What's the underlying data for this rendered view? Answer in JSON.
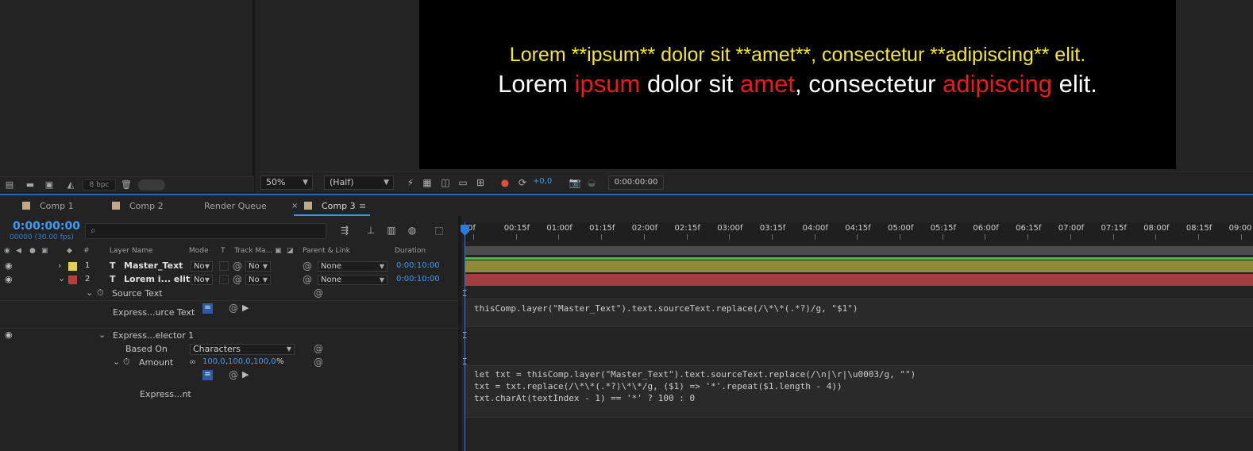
{
  "viewer": {
    "line1": [
      "Lorem ",
      "**ipsum**",
      " dolor sit ",
      "**amet**",
      ", consectetur ",
      "**adipiscing**",
      " elit."
    ],
    "line2_a": "Lorem ",
    "line2_b": "ipsum",
    "line2_c": " dolor sit ",
    "line2_d": "amet",
    "line2_e": ", consectetur ",
    "line2_f": "adipiscing",
    "line2_g": " elit.",
    "zoom": "50%",
    "resolution": "(Half)",
    "exposure": "+0,0",
    "timecode": "0:00:00:00"
  },
  "project": {
    "bpc": "8 bpc"
  },
  "tabs": [
    {
      "label": "Comp 1"
    },
    {
      "label": "Comp 2"
    },
    {
      "label": "Render Queue"
    },
    {
      "label": "Comp 3"
    }
  ],
  "timeline": {
    "current_time": "0:00:00:00",
    "current_frames": "00000 (30.00 fps)",
    "columns": {
      "num": "#",
      "layer_name": "Layer Name",
      "mode": "Mode",
      "t": "T",
      "track_matte": "Track Ma...",
      "parent": "Parent & Link",
      "duration": "Duration"
    },
    "layers": [
      {
        "num": "1",
        "name": "Master_Text",
        "mode": "No",
        "track": "No",
        "parent": "None",
        "duration": "0:00:10:00"
      },
      {
        "num": "2",
        "name": "Lorem i... elit.",
        "mode": "No",
        "track": "No",
        "parent": "None",
        "duration": "0:00:10:00"
      }
    ],
    "props": {
      "source_text": "Source Text",
      "expr_source": "Express...urce Text",
      "expr_selector": "Express...elector 1",
      "based_on": "Based On",
      "based_on_value": "Characters",
      "amount": "Amount",
      "amount_v1": "100,0",
      "amount_v2": "100,0",
      "amount_v3": "100,0",
      "amount_unit": "%",
      "expr_amount": "Express...nt"
    },
    "ruler": [
      "0f",
      "00:15f",
      "01:00f",
      "01:15f",
      "02:00f",
      "02:15f",
      "03:00f",
      "03:15f",
      "04:00f",
      "04:15f",
      "05:00f",
      "05:15f",
      "06:00f",
      "06:15f",
      "07:00f",
      "07:15f",
      "08:00f",
      "08:15f",
      "09:00"
    ],
    "code1": "thisComp.layer(\"Master_Text\").text.sourceText.replace(/\\*\\*(.*?)/g, \"$1\")",
    "code2": "let txt = thisComp.layer(\"Master_Text\").text.sourceText.replace(/\\n|\\r|\\u0003/g, \"\")\ntxt = txt.replace(/\\*\\*(.*?)\\*\\*/g, ($1) => '*'.repeat($1.length - 4))\ntxt.charAt(textIndex - 1) == '*' ? 100 : 0"
  },
  "colors": {
    "accent": "#3f9cf5",
    "layer1_label": "#e3cf56",
    "layer2_label": "#c23b3b"
  }
}
